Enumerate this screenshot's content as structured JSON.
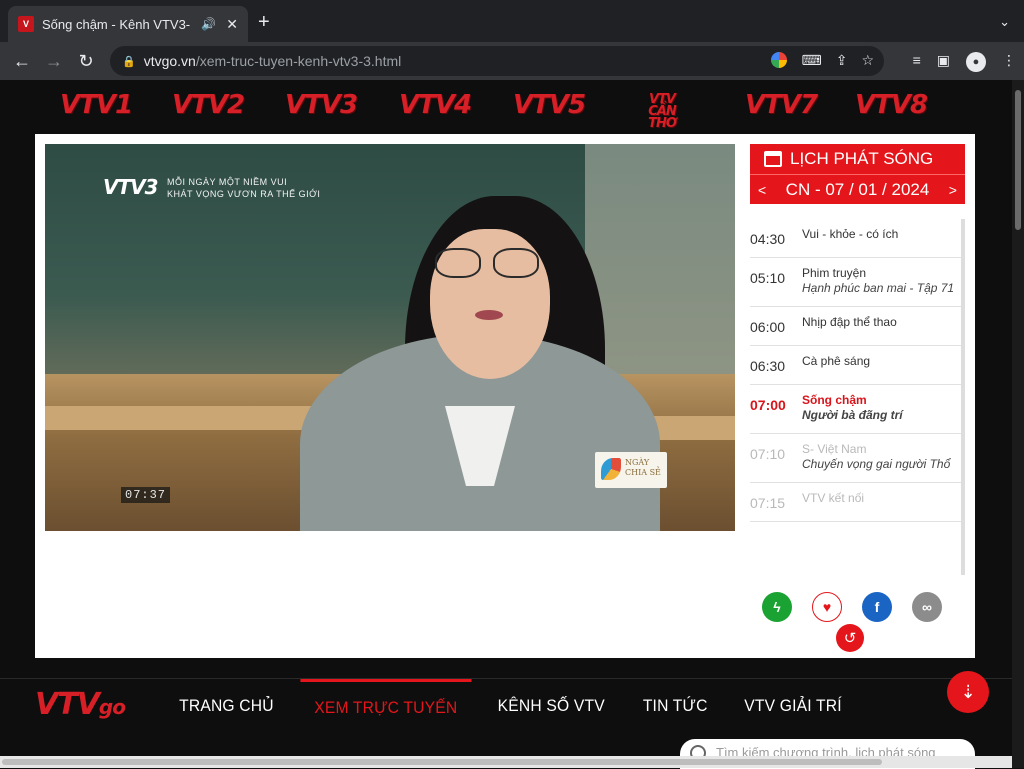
{
  "browser": {
    "tab_title": "Sống chậm - Kênh VTV3-",
    "tab_favicon": "vtv",
    "url_host": "vtvgo.vn",
    "url_path": "/xem-truc-tuyen-kenh-vtv3-3.html"
  },
  "channels": [
    "VTV1",
    "VTV2",
    "VTV3",
    "VTV4",
    "VTV5",
    "VTV CẦN THƠ",
    "VTV7",
    "VTV8"
  ],
  "player": {
    "slogan_line1": "MỖI NGÀY MỘT NIỀM VUI",
    "slogan_line2": "KHÁT VỌNG VƯƠN RA THẾ GIỚI",
    "osd_logo": "VTV3",
    "osd_time": "07:37",
    "badge_line1": "NGÀY",
    "badge_line2": "CHIA SẺ"
  },
  "schedule": {
    "title": "LỊCH PHÁT SÓNG",
    "date": "CN - 07 / 01 / 2024",
    "prev": "<",
    "next": ">",
    "items": [
      {
        "time": "04:30",
        "title": "Vui - khỏe - có ích",
        "subtitle": "",
        "state": "past"
      },
      {
        "time": "05:10",
        "title": "Phim truyện",
        "subtitle": "Hạnh phúc ban mai - Tập 71",
        "state": "past"
      },
      {
        "time": "06:00",
        "title": "Nhịp đập thể thao",
        "subtitle": "",
        "state": "past"
      },
      {
        "time": "06:30",
        "title": "Cà phê sáng",
        "subtitle": "",
        "state": "past"
      },
      {
        "time": "07:00",
        "title": "Sống chậm",
        "subtitle": "Người bà đãng trí",
        "state": "live"
      },
      {
        "time": "07:10",
        "title": "S- Việt Nam",
        "subtitle": "Chuyến vọng gai người Thổ",
        "state": "future"
      },
      {
        "time": "07:15",
        "title": "VTV kết nối",
        "subtitle": "",
        "state": "future"
      }
    ]
  },
  "footer": {
    "logo": "VTV",
    "logo_go": "go",
    "menu": [
      "TRANG CHỦ",
      "XEM TRỰC TUYẾN",
      "KÊNH SỐ VTV",
      "TIN TỨC",
      "VTV GIẢI TRÍ"
    ],
    "active_menu": 1,
    "search_placeholder": "Tìm kiếm chương trình, lịch phát sóng"
  },
  "colors": {
    "brand_red": "#e4161b",
    "share_green": "#1aa332",
    "facebook_blue": "#1a64c4"
  }
}
